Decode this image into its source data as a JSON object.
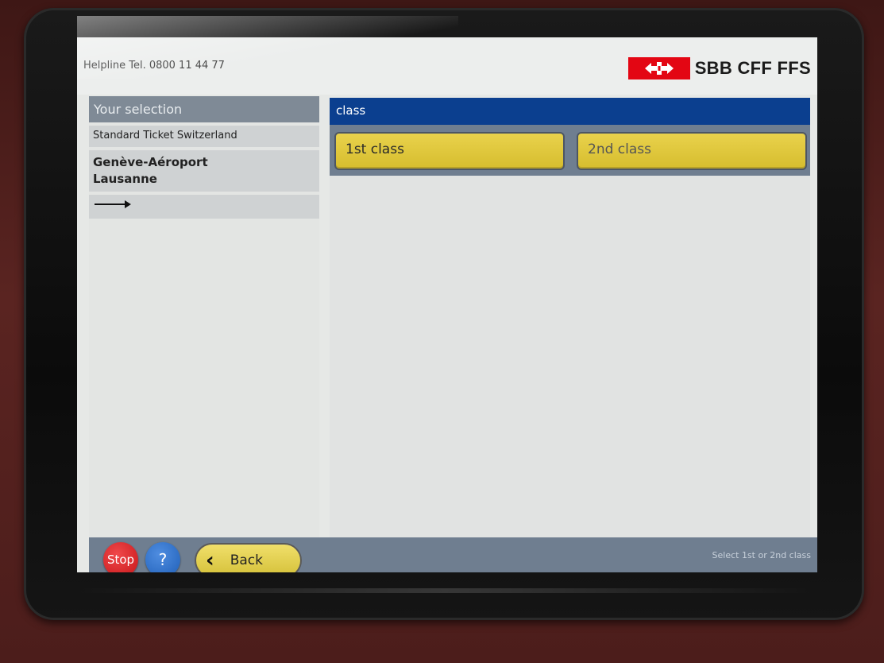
{
  "header": {
    "helpline": "Helpline  Tel. 0800 11 44 77",
    "logo_text": "SBB CFF FFS",
    "logo_icon": "swiss-cross-arrows-icon",
    "brand_color": "#e30613"
  },
  "selection": {
    "title": "Your selection",
    "ticket_type": "Standard Ticket Switzerland",
    "route_from": "Genève-Aéroport",
    "route_to": "Lausanne",
    "direction_icon": "arrow-right-icon"
  },
  "class_panel": {
    "title": "class",
    "options": [
      "1st class",
      "2nd class"
    ],
    "header_color": "#0b3f8f",
    "button_color": "#e1c83c"
  },
  "footer": {
    "stop_label": "Stop",
    "help_label": "?",
    "back_label": "Back",
    "status": "Select 1st or 2nd class"
  }
}
